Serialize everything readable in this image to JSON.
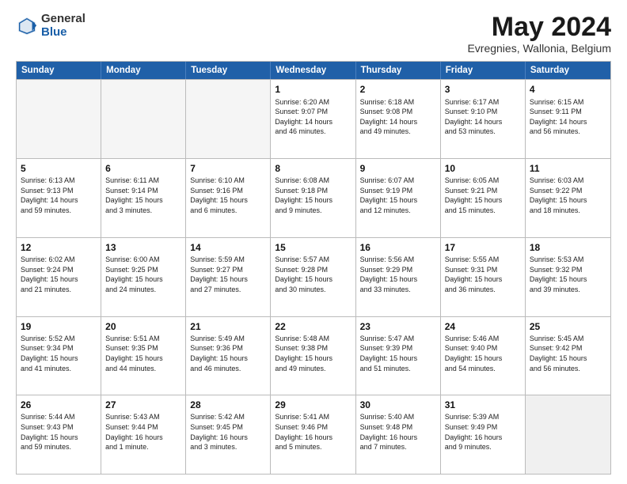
{
  "logo": {
    "general": "General",
    "blue": "Blue"
  },
  "title": "May 2024",
  "subtitle": "Evregnies, Wallonia, Belgium",
  "headers": [
    "Sunday",
    "Monday",
    "Tuesday",
    "Wednesday",
    "Thursday",
    "Friday",
    "Saturday"
  ],
  "weeks": [
    [
      {
        "day": "",
        "info": ""
      },
      {
        "day": "",
        "info": ""
      },
      {
        "day": "",
        "info": ""
      },
      {
        "day": "1",
        "info": "Sunrise: 6:20 AM\nSunset: 9:07 PM\nDaylight: 14 hours\nand 46 minutes."
      },
      {
        "day": "2",
        "info": "Sunrise: 6:18 AM\nSunset: 9:08 PM\nDaylight: 14 hours\nand 49 minutes."
      },
      {
        "day": "3",
        "info": "Sunrise: 6:17 AM\nSunset: 9:10 PM\nDaylight: 14 hours\nand 53 minutes."
      },
      {
        "day": "4",
        "info": "Sunrise: 6:15 AM\nSunset: 9:11 PM\nDaylight: 14 hours\nand 56 minutes."
      }
    ],
    [
      {
        "day": "5",
        "info": "Sunrise: 6:13 AM\nSunset: 9:13 PM\nDaylight: 14 hours\nand 59 minutes."
      },
      {
        "day": "6",
        "info": "Sunrise: 6:11 AM\nSunset: 9:14 PM\nDaylight: 15 hours\nand 3 minutes."
      },
      {
        "day": "7",
        "info": "Sunrise: 6:10 AM\nSunset: 9:16 PM\nDaylight: 15 hours\nand 6 minutes."
      },
      {
        "day": "8",
        "info": "Sunrise: 6:08 AM\nSunset: 9:18 PM\nDaylight: 15 hours\nand 9 minutes."
      },
      {
        "day": "9",
        "info": "Sunrise: 6:07 AM\nSunset: 9:19 PM\nDaylight: 15 hours\nand 12 minutes."
      },
      {
        "day": "10",
        "info": "Sunrise: 6:05 AM\nSunset: 9:21 PM\nDaylight: 15 hours\nand 15 minutes."
      },
      {
        "day": "11",
        "info": "Sunrise: 6:03 AM\nSunset: 9:22 PM\nDaylight: 15 hours\nand 18 minutes."
      }
    ],
    [
      {
        "day": "12",
        "info": "Sunrise: 6:02 AM\nSunset: 9:24 PM\nDaylight: 15 hours\nand 21 minutes."
      },
      {
        "day": "13",
        "info": "Sunrise: 6:00 AM\nSunset: 9:25 PM\nDaylight: 15 hours\nand 24 minutes."
      },
      {
        "day": "14",
        "info": "Sunrise: 5:59 AM\nSunset: 9:27 PM\nDaylight: 15 hours\nand 27 minutes."
      },
      {
        "day": "15",
        "info": "Sunrise: 5:57 AM\nSunset: 9:28 PM\nDaylight: 15 hours\nand 30 minutes."
      },
      {
        "day": "16",
        "info": "Sunrise: 5:56 AM\nSunset: 9:29 PM\nDaylight: 15 hours\nand 33 minutes."
      },
      {
        "day": "17",
        "info": "Sunrise: 5:55 AM\nSunset: 9:31 PM\nDaylight: 15 hours\nand 36 minutes."
      },
      {
        "day": "18",
        "info": "Sunrise: 5:53 AM\nSunset: 9:32 PM\nDaylight: 15 hours\nand 39 minutes."
      }
    ],
    [
      {
        "day": "19",
        "info": "Sunrise: 5:52 AM\nSunset: 9:34 PM\nDaylight: 15 hours\nand 41 minutes."
      },
      {
        "day": "20",
        "info": "Sunrise: 5:51 AM\nSunset: 9:35 PM\nDaylight: 15 hours\nand 44 minutes."
      },
      {
        "day": "21",
        "info": "Sunrise: 5:49 AM\nSunset: 9:36 PM\nDaylight: 15 hours\nand 46 minutes."
      },
      {
        "day": "22",
        "info": "Sunrise: 5:48 AM\nSunset: 9:38 PM\nDaylight: 15 hours\nand 49 minutes."
      },
      {
        "day": "23",
        "info": "Sunrise: 5:47 AM\nSunset: 9:39 PM\nDaylight: 15 hours\nand 51 minutes."
      },
      {
        "day": "24",
        "info": "Sunrise: 5:46 AM\nSunset: 9:40 PM\nDaylight: 15 hours\nand 54 minutes."
      },
      {
        "day": "25",
        "info": "Sunrise: 5:45 AM\nSunset: 9:42 PM\nDaylight: 15 hours\nand 56 minutes."
      }
    ],
    [
      {
        "day": "26",
        "info": "Sunrise: 5:44 AM\nSunset: 9:43 PM\nDaylight: 15 hours\nand 59 minutes."
      },
      {
        "day": "27",
        "info": "Sunrise: 5:43 AM\nSunset: 9:44 PM\nDaylight: 16 hours\nand 1 minute."
      },
      {
        "day": "28",
        "info": "Sunrise: 5:42 AM\nSunset: 9:45 PM\nDaylight: 16 hours\nand 3 minutes."
      },
      {
        "day": "29",
        "info": "Sunrise: 5:41 AM\nSunset: 9:46 PM\nDaylight: 16 hours\nand 5 minutes."
      },
      {
        "day": "30",
        "info": "Sunrise: 5:40 AM\nSunset: 9:48 PM\nDaylight: 16 hours\nand 7 minutes."
      },
      {
        "day": "31",
        "info": "Sunrise: 5:39 AM\nSunset: 9:49 PM\nDaylight: 16 hours\nand 9 minutes."
      },
      {
        "day": "",
        "info": ""
      }
    ]
  ]
}
